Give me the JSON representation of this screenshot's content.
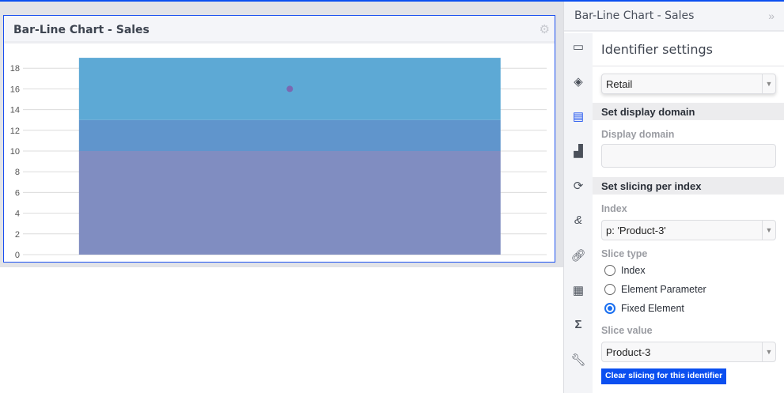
{
  "widget": {
    "title": "Bar-Line Chart - Sales",
    "settings_icon": "gear-icon"
  },
  "chart_data": {
    "type": "bar",
    "stacked": true,
    "categories": [
      ""
    ],
    "series": [
      {
        "type": "bar",
        "values": [
          10
        ],
        "color": "#808dc1"
      },
      {
        "type": "bar",
        "values": [
          3
        ],
        "color": "#6095cc"
      },
      {
        "type": "bar",
        "values": [
          6
        ],
        "color": "#5da9d5"
      },
      {
        "type": "line",
        "values": [
          16
        ],
        "color": "#7a68b2"
      }
    ],
    "yticks": [
      0,
      2,
      4,
      6,
      8,
      10,
      12,
      14,
      16,
      18
    ],
    "ylim": [
      0,
      19
    ],
    "grid": true,
    "title": "",
    "xlabel": "",
    "ylabel": ""
  },
  "panel": {
    "title": "Bar-Line Chart - Sales",
    "collapse_icon": "double-chevron-right-icon",
    "section_title": "Identifier settings",
    "identifier_select": "Retail",
    "display_domain_header": "Set display domain",
    "display_domain_label": "Display domain",
    "display_domain_value": "",
    "slicing_header": "Set slicing per index",
    "index_label": "Index",
    "index_select": "p: 'Product-3'",
    "slice_type_label": "Slice type",
    "slice_types": [
      {
        "label": "Index",
        "selected": false
      },
      {
        "label": "Element Parameter",
        "selected": false
      },
      {
        "label": "Fixed Element",
        "selected": true
      }
    ],
    "slice_value_label": "Slice value",
    "slice_value_select": "Product-3",
    "clear_button": "Clear slicing for this identifier"
  },
  "sidebar_icons": [
    "inbox-icon",
    "layers-icon",
    "document-icon",
    "chart-growth-icon",
    "refresh-icon",
    "ampersand-icon",
    "link-icon",
    "table-icon",
    "sigma-icon",
    "wrench-icon"
  ]
}
